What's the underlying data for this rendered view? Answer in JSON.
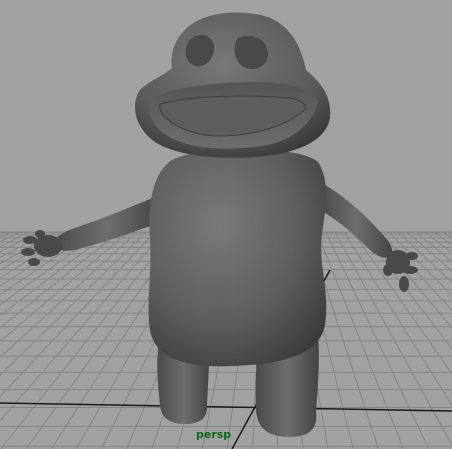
{
  "viewport": {
    "camera_label": "persp",
    "colors": {
      "background": "#a1a1a1",
      "grid_line": "#858585",
      "grid_axis": "#1a1a1a",
      "camera_label": "#0a6a1a",
      "model_mid": "#6a6a6a",
      "model_dark": "#3a3a3a"
    },
    "model": "frog-character-mesh"
  }
}
